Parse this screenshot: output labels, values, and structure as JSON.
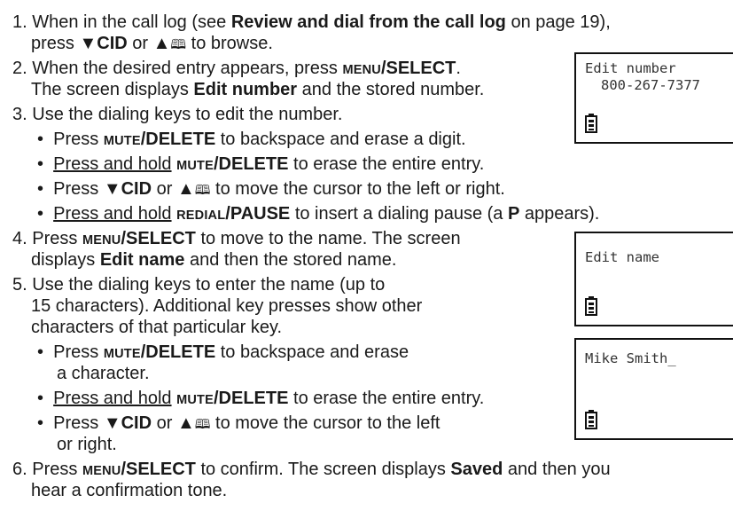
{
  "glyphs": {
    "down": "▼",
    "up": "▲",
    "book": "🕮"
  },
  "step1": {
    "num": "1.",
    "a": "When in the call log (see ",
    "b": "Review and dial from the call log",
    "c": " on page 19),",
    "d": "press ",
    "cid": "CID",
    "or": " or ",
    "e": " to browse."
  },
  "step2": {
    "num": "2.",
    "a": "When the desired entry appears, press ",
    "menu": "MENU",
    "select": "/SELECT",
    "dot": ".",
    "b": "The screen displays ",
    "edit_number": "Edit number",
    "c": " and the stored number."
  },
  "step3": {
    "num": "3.",
    "text": "Use the dialing keys to edit the number.",
    "b1": {
      "a": "Press ",
      "mute": "MUTE",
      "del": "/DELETE",
      "b": " to backspace and erase a digit."
    },
    "b2": {
      "hold": "Press and hold",
      "sp": " ",
      "mute": "MUTE",
      "del": "/DELETE",
      "b": " to erase the entire entry."
    },
    "b3": {
      "a": "Press ",
      "cid": "CID",
      "or": " or ",
      "b": " to move the cursor to the left or right."
    },
    "b4": {
      "hold": "Press and hold",
      "sp": " ",
      "redial": "REDIAL",
      "pause": "/PAUSE",
      "b": " to insert a dialing pause (a ",
      "p": "P",
      "c": " appears)."
    }
  },
  "step4": {
    "num": "4.",
    "a": "Press ",
    "menu": "MENU",
    "select": "/SELECT",
    "b": " to move to the name. The screen",
    "c": "displays ",
    "edit_name": "Edit name",
    "d": " and then the stored name."
  },
  "step5": {
    "num": "5.",
    "l1": "Use the dialing keys to enter the name (up to",
    "l2": "15 characters). Additional key presses show other",
    "l3": "characters of that particular key.",
    "b1": {
      "a": "Press ",
      "mute": "MUTE",
      "del": "/DELETE",
      "b": " to backspace and erase",
      "c": "a character."
    },
    "b2": {
      "hold": "Press and hold",
      "sp": " ",
      "mute": "MUTE",
      "del": "/DELETE",
      "b": " to erase the entire entry."
    },
    "b3": {
      "a": "Press ",
      "cid": "CID",
      "or": " or ",
      "b": " to move the cursor to the left",
      "c": "or right."
    }
  },
  "step6": {
    "num": "6.",
    "a": "Press ",
    "menu": "MENU",
    "select": "/SELECT",
    "b": " to confirm. The screen displays ",
    "saved": "Saved",
    "c": " and then you",
    "d": "hear a confirmation tone."
  },
  "screens": [
    {
      "line1": "Edit number",
      "line2": "800-267-7377"
    },
    {
      "line1": "Edit name",
      "line2": ""
    },
    {
      "line1": "Mike Smith_",
      "line2": ""
    }
  ]
}
